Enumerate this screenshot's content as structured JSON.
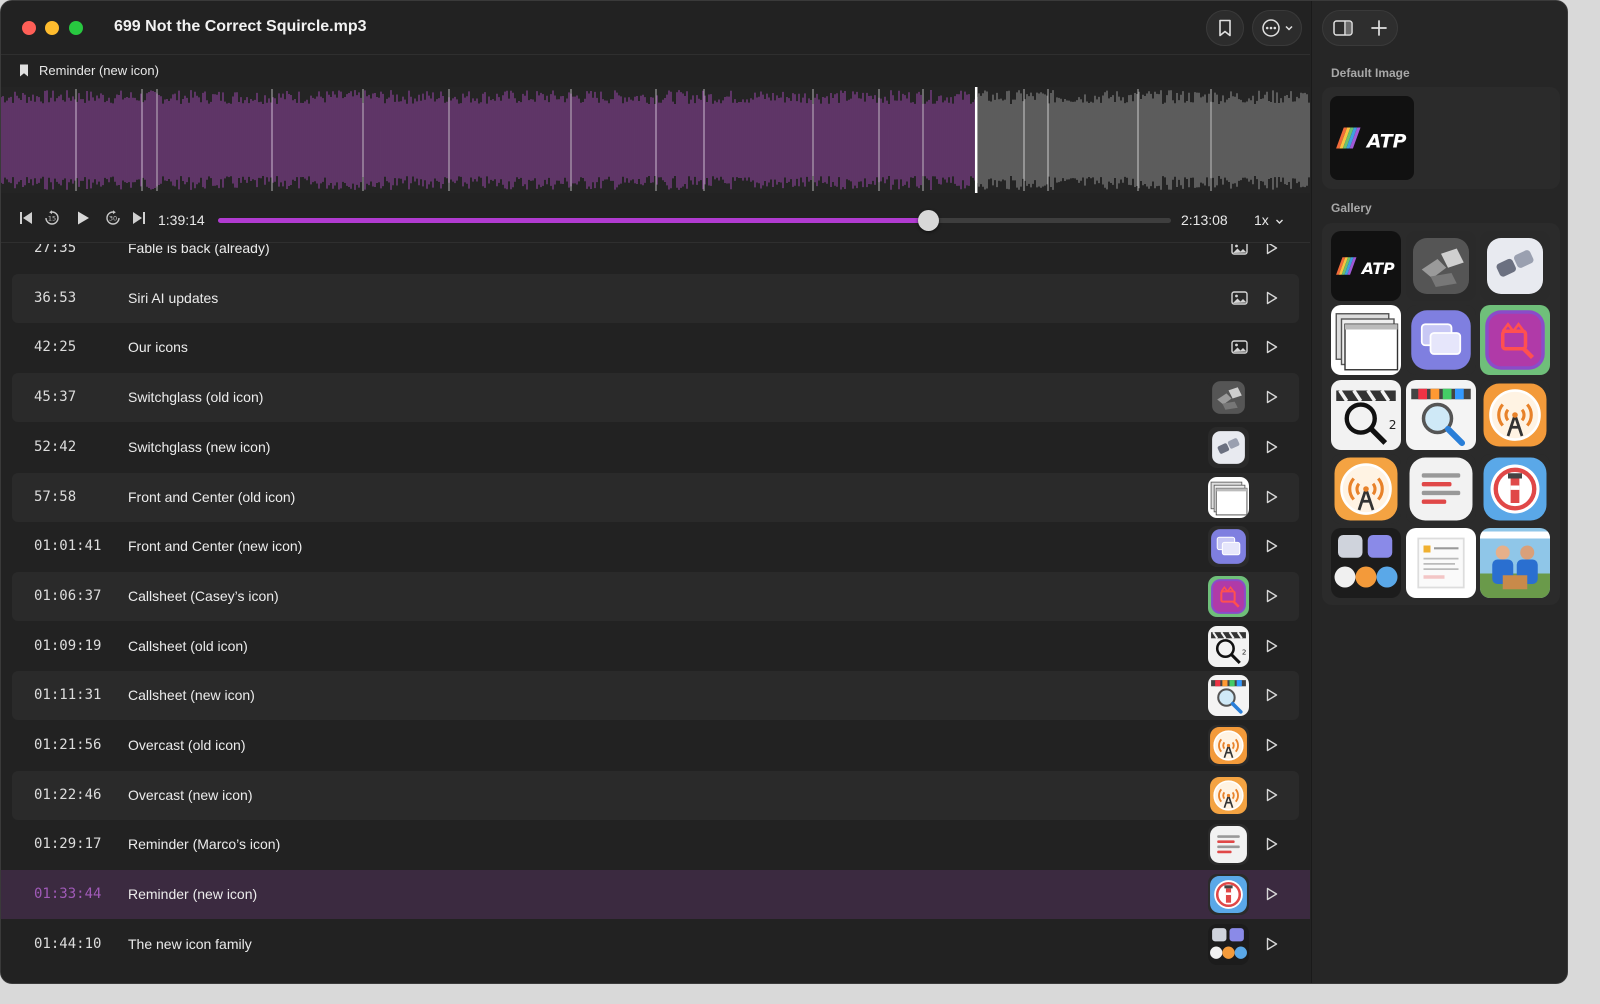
{
  "window": {
    "title": "699 Not the Correct Squircle.mp3",
    "accent": "#b13bd1"
  },
  "chapter_bar": {
    "label": "Reminder (new icon)"
  },
  "player": {
    "current_time": "1:39:14",
    "total_time": "2:13:08",
    "speed": "1x",
    "progress": 0.745,
    "waveform_played_fraction": 0.745
  },
  "chapters": [
    {
      "time": "27:35",
      "title": "Fable is back (already)",
      "art": "image-icon"
    },
    {
      "time": "36:53",
      "title": "Siri AI updates",
      "art": "image-icon"
    },
    {
      "time": "42:25",
      "title": "Our icons",
      "art": "image-icon"
    },
    {
      "time": "45:37",
      "title": "Switchglass (old icon)",
      "art": "switchglass-old"
    },
    {
      "time": "52:42",
      "title": "Switchglass (new icon)",
      "art": "switchglass-new"
    },
    {
      "time": "57:58",
      "title": "Front and Center (old icon)",
      "art": "fac-old"
    },
    {
      "time": "01:01:41",
      "title": "Front and Center (new icon)",
      "art": "fac-new"
    },
    {
      "time": "01:06:37",
      "title": "Callsheet (Casey’s icon)",
      "art": "callsheet-casey"
    },
    {
      "time": "01:09:19",
      "title": "Callsheet (old icon)",
      "art": "callsheet-old"
    },
    {
      "time": "01:11:31",
      "title": "Callsheet (new icon)",
      "art": "callsheet-new"
    },
    {
      "time": "01:21:56",
      "title": "Overcast (old icon)",
      "art": "overcast-old"
    },
    {
      "time": "01:22:46",
      "title": "Overcast (new icon)",
      "art": "overcast-new"
    },
    {
      "time": "01:29:17",
      "title": "Reminder (Marco’s icon)",
      "art": "reminder-marco"
    },
    {
      "time": "01:33:44",
      "title": "Reminder (new icon)",
      "art": "reminder-new",
      "active": true
    },
    {
      "time": "01:44:10",
      "title": "The new icon family",
      "art": "icon-family"
    }
  ],
  "sidebar": {
    "default_label": "Default Image",
    "gallery_label": "Gallery",
    "default_art": "atp-logo",
    "logo_text": "ATP",
    "gallery": [
      "atp-logo",
      "switchglass-old",
      "switchglass-new",
      "fac-old",
      "fac-new",
      "callsheet-casey",
      "callsheet-old",
      "callsheet-new",
      "overcast-old",
      "overcast-new",
      "reminder-marco",
      "reminder-new",
      "icon-family",
      "document-page",
      "photo-people"
    ]
  }
}
